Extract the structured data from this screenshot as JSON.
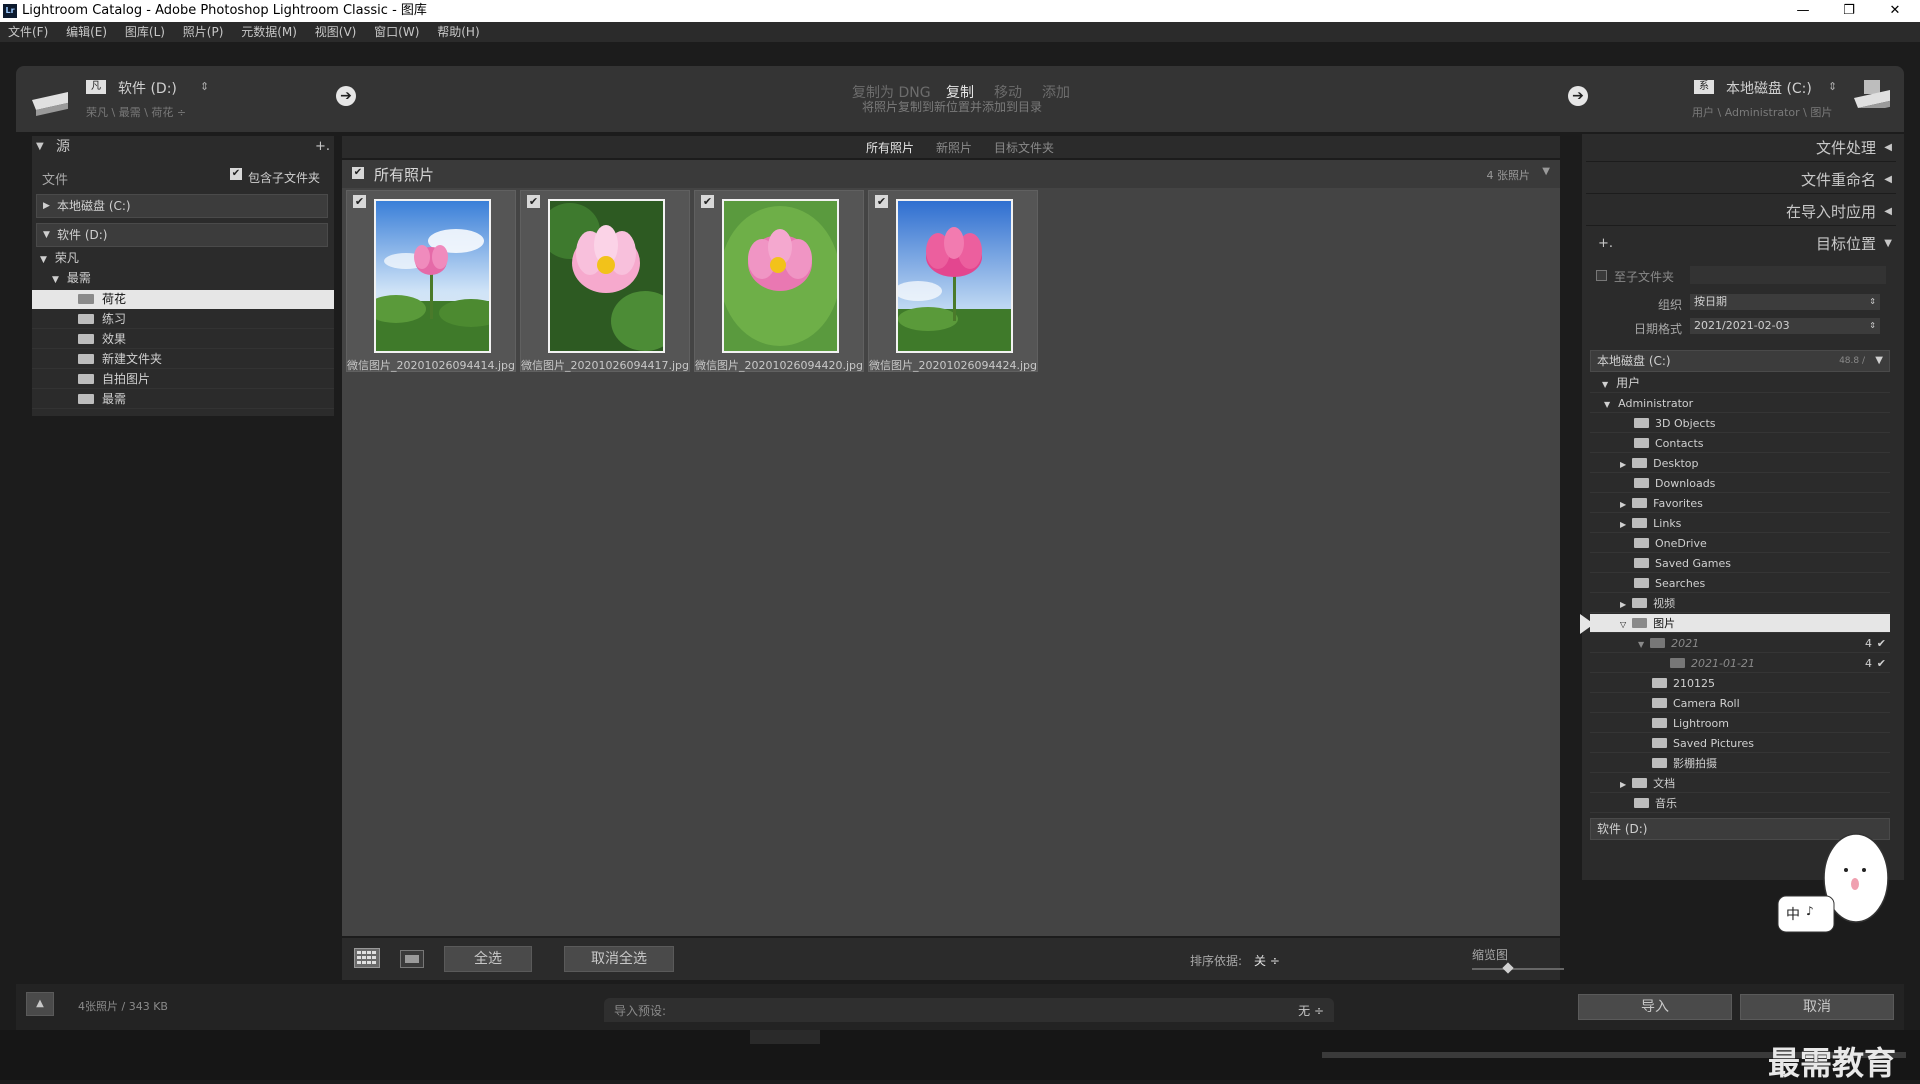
{
  "window": {
    "title": "Lightroom Catalog - Adobe Photoshop Lightroom Classic - 图库",
    "logo_text": "Lr",
    "minimize": "—",
    "maximize": "❐",
    "close": "✕"
  },
  "menu": [
    "文件(F)",
    "编辑(E)",
    "图库(L)",
    "照片(P)",
    "元数据(M)",
    "视图(V)",
    "窗口(W)",
    "帮助(H)"
  ],
  "source": {
    "drive": "软件 (D:)",
    "path": "荣凡 \\ 最需 \\ 荷花 ÷"
  },
  "modes": {
    "dng": "复制为 DNG",
    "copy": "复制",
    "move": "移动",
    "add": "添加",
    "desc": "将照片复制到新位置并添加到目录"
  },
  "destination": {
    "drive": "本地磁盘 (C:)",
    "path": "用户 \\ Administrator \\ 图片"
  },
  "left_panel": {
    "title": "源",
    "plus": "+.",
    "files_label": "文件",
    "include_subfolders": "包含子文件夹",
    "drives": [
      "本地磁盘 (C:)",
      "软件 (D:)"
    ],
    "tree": {
      "level1": "荣凡",
      "level2": "最需",
      "folders": [
        "荷花",
        "练习",
        "效果",
        "新建文件夹",
        "自拍图片",
        "最需"
      ]
    }
  },
  "center": {
    "tabs": [
      "所有照片",
      "新照片",
      "目标文件夹"
    ],
    "header_title": "所有照片",
    "header_count": "4 张照片",
    "photos": [
      {
        "name": "微信图片_20201026094414.jpg"
      },
      {
        "name": "微信图片_20201026094417.jpg"
      },
      {
        "name": "微信图片_20201026094420.jpg"
      },
      {
        "name": "微信图片_20201026094424.jpg"
      }
    ],
    "toolbar": {
      "select_all": "全选",
      "deselect_all": "取消全选",
      "sort_label": "排序依据:",
      "sort_value": "关 ÷",
      "thumb_label": "缩览图"
    }
  },
  "right_panel": {
    "sections": [
      "文件处理",
      "文件重命名",
      "在导入时应用",
      "目标位置"
    ],
    "into_subfolder": "至子文件夹",
    "organize_label": "组织",
    "organize_value": "按日期",
    "date_format_label": "日期格式",
    "date_format_value": "2021/2021-02-03",
    "drive_c": "本地磁盘 (C:)",
    "drive_c_space": "48.8 /",
    "drive_d": "软件 (D:)",
    "tree": {
      "users": "用户",
      "admin": "Administrator",
      "items": [
        "3D Objects",
        "Contacts",
        "Desktop",
        "Downloads",
        "Favorites",
        "Links",
        "OneDrive",
        "Saved Games",
        "Searches",
        "视频",
        "图片"
      ],
      "pictures_children": [
        "2021",
        "2021-01-21",
        "210125",
        "Camera Roll",
        "Lightroom",
        "Saved Pictures",
        "影棚拍摄"
      ],
      "after": [
        "文档",
        "音乐"
      ],
      "count_2021": "4",
      "count_2021_01_21": "4"
    }
  },
  "bottom": {
    "photo_info": "4张照片 / 343 KB",
    "preset_label": "导入预设:",
    "preset_value": "无 ÷",
    "import": "导入",
    "cancel": "取消",
    "watermark": "最需教育",
    "ime_label": "中",
    "ime_punct": "♪"
  }
}
